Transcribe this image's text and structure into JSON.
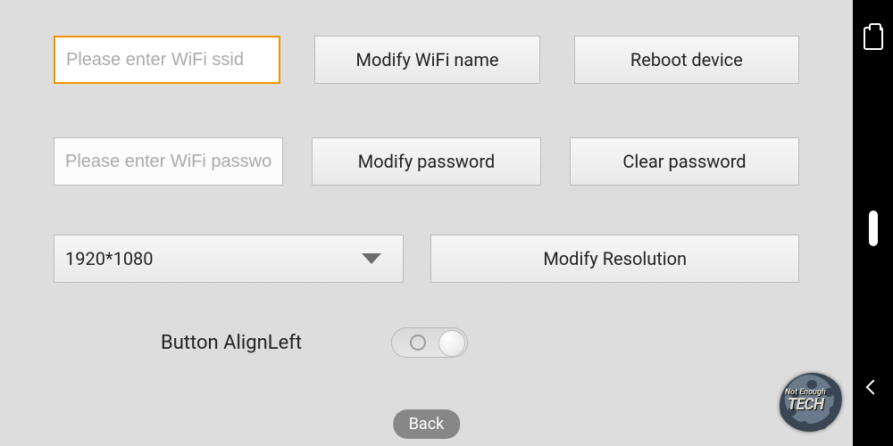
{
  "row1": {
    "ssid_placeholder": "Please enter WiFi ssid",
    "ssid_value": "",
    "modify_name_btn": "Modify WiFi name",
    "reboot_btn": "Reboot device"
  },
  "row2": {
    "pwd_placeholder": "Please enter WiFi passwor",
    "pwd_value": "",
    "modify_pwd_btn": "Modify password",
    "clear_pwd_btn": "Clear password"
  },
  "row3": {
    "resolution_selected": "1920*1080",
    "modify_res_btn": "Modify Resolution"
  },
  "toggle": {
    "label": "Button AlignLeft",
    "state": "off"
  },
  "back_toast": "Back",
  "watermark": {
    "line1": "Not",
    "line2": "Enough",
    "brand": "TECH"
  },
  "navbar": {
    "clipboard_icon": "clipboard",
    "handle": "gesture-handle",
    "back_caret": "back"
  }
}
